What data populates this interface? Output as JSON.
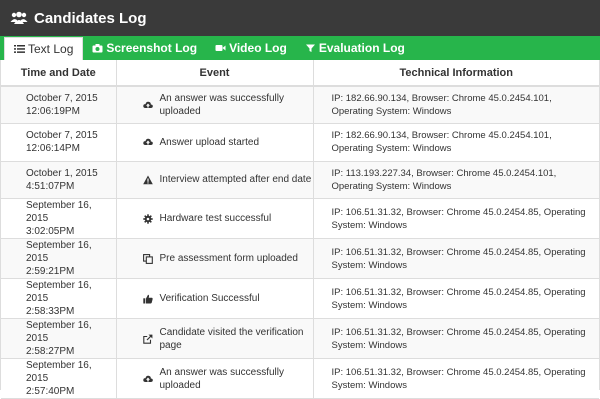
{
  "header": {
    "title": "Candidates Log",
    "icon": "users-icon"
  },
  "tabs": [
    {
      "label": "Text Log",
      "icon": "list-icon",
      "active": true
    },
    {
      "label": "Screenshot Log",
      "icon": "camera-icon",
      "active": false
    },
    {
      "label": "Video Log",
      "icon": "video-camera-icon",
      "active": false
    },
    {
      "label": "Evaluation Log",
      "icon": "filter-icon",
      "active": false
    }
  ],
  "table": {
    "columns": [
      "Time and Date",
      "Event",
      "Technical Information"
    ],
    "rows": [
      {
        "date": "October 7, 2015",
        "time": "12:06:19PM",
        "event": "An answer was successfully uploaded",
        "icon": "cloud-upload-icon",
        "tech": "IP: 182.66.90.134, Browser: Chrome 45.0.2454.101, Operating System: Windows"
      },
      {
        "date": "October 7, 2015",
        "time": "12:06:14PM",
        "event": "Answer upload started",
        "icon": "cloud-upload-icon",
        "tech": "IP: 182.66.90.134, Browser: Chrome 45.0.2454.101, Operating System: Windows"
      },
      {
        "date": "October 1, 2015",
        "time": "4:51:07PM",
        "event": "Interview attempted after end date",
        "icon": "warning-icon",
        "tech": "IP: 113.193.227.34, Browser: Chrome 45.0.2454.101, Operating System: Windows"
      },
      {
        "date": "September 16, 2015",
        "time": "3:02:05PM",
        "event": "Hardware test successful",
        "icon": "gear-icon",
        "tech": "IP: 106.51.31.32, Browser: Chrome 45.0.2454.85, Operating System: Windows"
      },
      {
        "date": "September 16, 2015",
        "time": "2:59:21PM",
        "event": "Pre assessment form uploaded",
        "icon": "copy-icon",
        "tech": "IP: 106.51.31.32, Browser: Chrome 45.0.2454.85, Operating System: Windows"
      },
      {
        "date": "September 16, 2015",
        "time": "2:58:33PM",
        "event": "Verification Successful",
        "icon": "thumbs-up-icon",
        "tech": "IP: 106.51.31.32, Browser: Chrome 45.0.2454.85, Operating System: Windows"
      },
      {
        "date": "September 16, 2015",
        "time": "2:58:27PM",
        "event": "Candidate visited the verification page",
        "icon": "external-link-icon",
        "tech": "IP: 106.51.31.32, Browser: Chrome 45.0.2454.85, Operating System: Windows"
      },
      {
        "date": "September 16, 2015",
        "time": "2:57:40PM",
        "event": "An answer was successfully uploaded",
        "icon": "cloud-upload-icon",
        "tech": "IP: 106.51.31.32, Browser: Chrome 45.0.2454.85, Operating System: Windows"
      }
    ]
  },
  "colors": {
    "header_bg": "#3a3a3a",
    "tab_bar_bg": "#27b54b",
    "row_alt_bg": "#f9f9f9",
    "border": "#dddddd"
  }
}
